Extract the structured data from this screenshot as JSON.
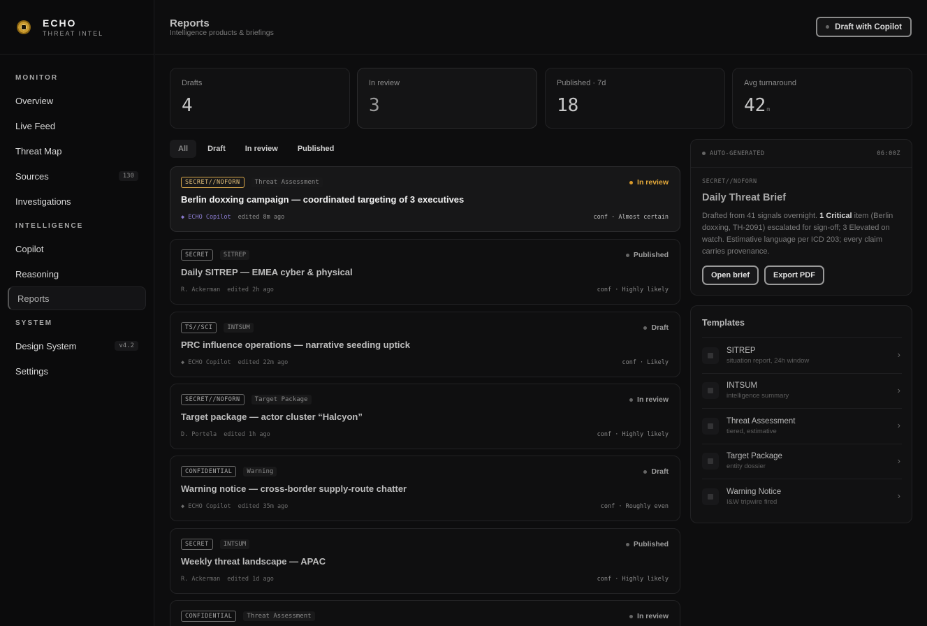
{
  "brand": {
    "name": "ECHO",
    "sub": "THREAT INTEL"
  },
  "sidebar": {
    "sections": [
      {
        "label": "MONITOR"
      },
      {
        "label": "INTELLIGENCE"
      },
      {
        "label": "SYSTEM"
      }
    ],
    "items": [
      {
        "label": "Overview"
      },
      {
        "label": "Live Feed"
      },
      {
        "label": "Threat Map"
      },
      {
        "label": "Sources",
        "badge": "130"
      },
      {
        "label": "Investigations"
      },
      {
        "label": "Copilot"
      },
      {
        "label": "Reasoning"
      },
      {
        "label": "Reports",
        "active": true
      },
      {
        "label": "Design System",
        "badge": "v4.2"
      },
      {
        "label": "Settings"
      }
    ]
  },
  "header": {
    "title": "Reports",
    "subtitle": "Intelligence products & briefings",
    "copilot_button": "Draft with Copilot"
  },
  "stats": [
    {
      "label": "Drafts",
      "value": "4"
    },
    {
      "label": "In review",
      "value": "3"
    },
    {
      "label": "Published · 7d",
      "value": "18"
    },
    {
      "label": "Avg turnaround",
      "value": "42",
      "unit": "m"
    }
  ],
  "filters": [
    "All",
    "Draft",
    "In review",
    "Published"
  ],
  "reports": [
    {
      "classification": "SECRET//NOFORN",
      "type": "Threat Assessment",
      "status": "In review",
      "title": "Berlin doxxing campaign — coordinated targeting of 3 executives",
      "author": "◆ ECHO Copilot",
      "edited": "edited 8m ago",
      "conf": "conf · Almost certain"
    },
    {
      "classification": "SECRET",
      "type": "SITREP",
      "status": "Published",
      "title": "Daily SITREP — EMEA cyber & physical",
      "author": "R. Ackerman",
      "edited": "edited 2h ago",
      "conf": "conf · Highly likely"
    },
    {
      "classification": "TS//SCI",
      "type": "INTSUM",
      "status": "Draft",
      "title": "PRC influence operations — narrative seeding uptick",
      "author": "◆ ECHO Copilot",
      "edited": "edited 22m ago",
      "conf": "conf · Likely"
    },
    {
      "classification": "SECRET//NOFORN",
      "type": "Target Package",
      "status": "In review",
      "title": "Target package — actor cluster “Halcyon”",
      "author": "D. Portela",
      "edited": "edited 1h ago",
      "conf": "conf · Highly likely"
    },
    {
      "classification": "CONFIDENTIAL",
      "type": "Warning",
      "status": "Draft",
      "title": "Warning notice — cross-border supply-route chatter",
      "author": "◆ ECHO Copilot",
      "edited": "edited 35m ago",
      "conf": "conf · Roughly even"
    },
    {
      "classification": "SECRET",
      "type": "INTSUM",
      "status": "Published",
      "title": "Weekly threat landscape — APAC",
      "author": "R. Ackerman",
      "edited": "edited 1d ago",
      "conf": "conf · Highly likely"
    },
    {
      "classification": "CONFIDENTIAL",
      "type": "Threat Assessment",
      "status": "In review",
      "title": "",
      "author": "",
      "edited": "",
      "conf": ""
    }
  ],
  "brief": {
    "tag": "AUTO-GENERATED",
    "time": "06:00Z",
    "classification": "SECRET//NOFORN",
    "title": "Daily Threat Brief",
    "body_pre": "Drafted from 41 signals overnight. ",
    "body_bold": "1 Critical",
    "body_post": " item (Berlin doxxing, TH-2091) escalated for sign-off; 3 Elevated on watch. Estimative language per ICD 203; every claim carries provenance.",
    "open_button": "Open brief",
    "export_button": "Export PDF"
  },
  "templates": {
    "title": "Templates",
    "items": [
      {
        "name": "SITREP",
        "desc": "situation report, 24h window"
      },
      {
        "name": "INTSUM",
        "desc": "intelligence summary"
      },
      {
        "name": "Threat Assessment",
        "desc": "tiered, estimative"
      },
      {
        "name": "Target Package",
        "desc": "entity dossier"
      },
      {
        "name": "Warning Notice",
        "desc": "I&W tripwire fired"
      }
    ]
  },
  "colors": {
    "accent_gold": "#e4a93a",
    "copilot_purple": "#8a7bd0"
  }
}
